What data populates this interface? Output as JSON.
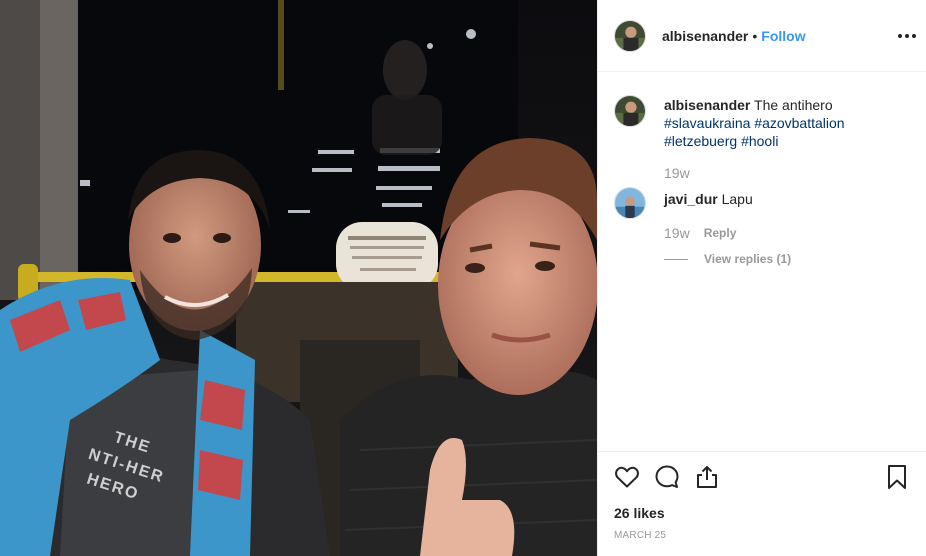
{
  "post": {
    "photo_alt": "",
    "author": {
      "username": "albisenander",
      "separator": "•",
      "follow_label": "Follow"
    },
    "caption": {
      "username": "albisenander",
      "text": "The antihero",
      "hashtags": [
        "#slavaukraina",
        "#azovbattalion",
        "#letzebuerg",
        "#hooli"
      ],
      "age": "19w"
    },
    "comments": [
      {
        "username": "javi_dur",
        "text": "Lapu",
        "age": "19w",
        "reply_label": "Reply",
        "view_replies_label": "View replies (1)"
      }
    ],
    "likes": "26 likes",
    "date": "MARCH 25"
  },
  "icons": {
    "more": "more-options-icon",
    "like": "heart-icon",
    "comment": "comment-bubble-icon",
    "share": "share-icon",
    "save": "bookmark-icon"
  },
  "colors": {
    "link_blue": "#3897f0",
    "hashtag": "#003569",
    "muted": "#999999",
    "text": "#262626",
    "divider": "#efefef"
  }
}
